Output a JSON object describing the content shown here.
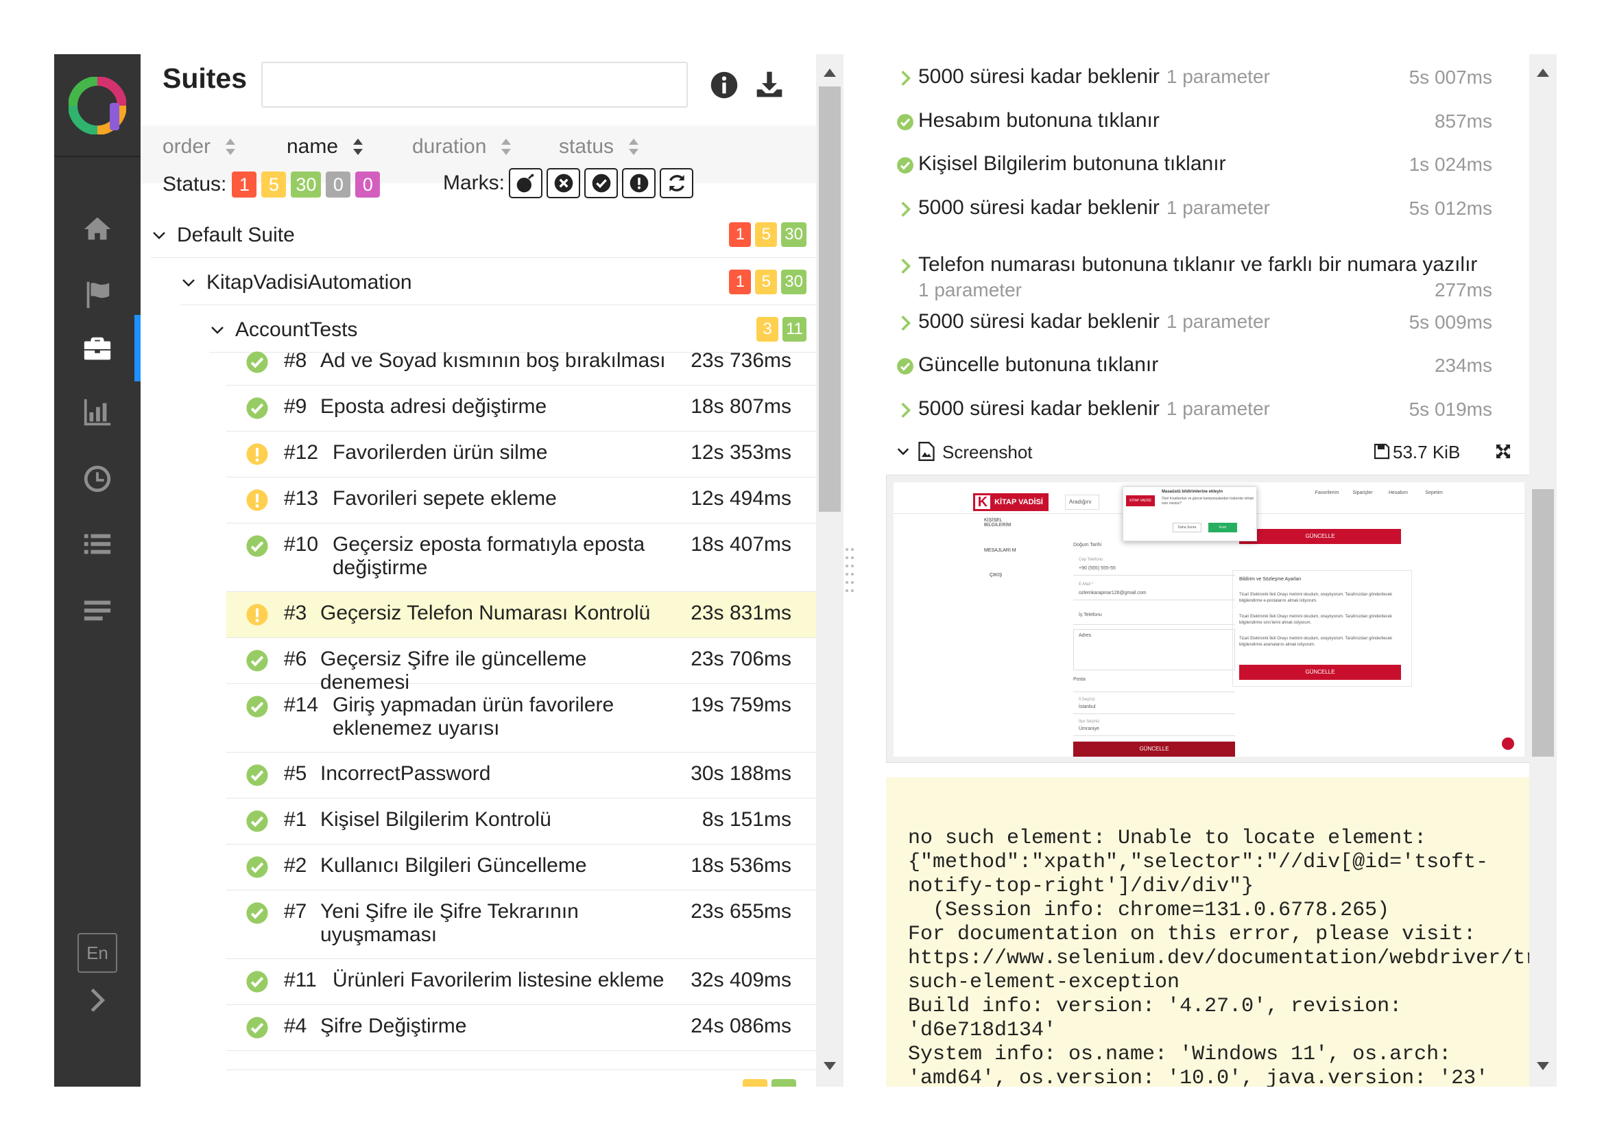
{
  "suites": {
    "title": "Suites",
    "search_placeholder": "",
    "sort": [
      {
        "label": "order"
      },
      {
        "label": "name"
      },
      {
        "label": "duration"
      },
      {
        "label": "status"
      }
    ],
    "status_label": "Status:",
    "status_counts": {
      "failed": "1",
      "broken": "5",
      "passed": "30",
      "skipped": "0",
      "unknown": "0"
    },
    "marks_label": "Marks:",
    "mark_icons": [
      "flaky-bomb-icon",
      "new-failed-icon",
      "new-passed-icon",
      "new-broken-icon",
      "retries-icon"
    ],
    "tree": {
      "default_suite": {
        "label": "Default Suite",
        "badges": [
          "1",
          "5",
          "30"
        ]
      },
      "package": {
        "label": "KitapVadisiAutomation",
        "badges": [
          "1",
          "5",
          "30"
        ]
      },
      "class": {
        "label": "AccountTests",
        "badges": [
          "3",
          "11"
        ]
      }
    },
    "tests": [
      {
        "num": "#8",
        "name": "Ad ve Soyad kısmının boş bırakılması",
        "duration": "23s 736ms",
        "status": "passed"
      },
      {
        "num": "#9",
        "name": "Eposta adresi değiştirme",
        "duration": "18s 807ms",
        "status": "passed"
      },
      {
        "num": "#12",
        "name": "Favorilerden ürün silme",
        "duration": "12s 353ms",
        "status": "broken"
      },
      {
        "num": "#13",
        "name": "Favorileri sepete ekleme",
        "duration": "12s 494ms",
        "status": "broken"
      },
      {
        "num": "#10",
        "name": "Geçersiz eposta formatıyla eposta değiştirme",
        "duration": "18s 407ms",
        "status": "passed"
      },
      {
        "num": "#3",
        "name": "Geçersiz Telefon Numarası Kontrolü",
        "duration": "23s 831ms",
        "status": "broken"
      },
      {
        "num": "#6",
        "name": "Geçersiz Şifre ile güncelleme denemesi",
        "duration": "23s 706ms",
        "status": "passed"
      },
      {
        "num": "#14",
        "name": "Giriş yapmadan ürün favorilere eklenemez uyarısı",
        "duration": "19s 759ms",
        "status": "passed"
      },
      {
        "num": "#5",
        "name": "IncorrectPassword",
        "duration": "30s 188ms",
        "status": "passed"
      },
      {
        "num": "#1",
        "name": "Kişisel Bilgilerim Kontrolü",
        "duration": "8s 151ms",
        "status": "passed"
      },
      {
        "num": "#2",
        "name": "Kullanıcı Bilgileri Güncelleme",
        "duration": "18s 536ms",
        "status": "passed"
      },
      {
        "num": "#7",
        "name": "Yeni Şifre ile Şifre Tekrarının uyuşmaması",
        "duration": "23s 655ms",
        "status": "passed"
      },
      {
        "num": "#11",
        "name": "Ürünleri Favorilerim listesine ekleme",
        "duration": "32s 409ms",
        "status": "passed"
      },
      {
        "num": "#4",
        "name": "Şifre Değiştirme",
        "duration": "24s 086ms",
        "status": "passed"
      }
    ]
  },
  "language": "En",
  "details": {
    "steps": [
      {
        "name": "5000 süresi kadar beklenir",
        "param": "1 parameter",
        "duration": "5s 007ms",
        "icon": "chevron-right"
      },
      {
        "name": "Hesabım butonuna tıklanır",
        "param": "",
        "duration": "857ms",
        "icon": "passed"
      },
      {
        "name": "Kişisel Bilgilerim butonuna tıklanır",
        "param": "",
        "duration": "1s 024ms",
        "icon": "passed"
      },
      {
        "name": "5000 süresi kadar beklenir",
        "param": "1 parameter",
        "duration": "5s 012ms",
        "icon": "chevron-right"
      },
      {
        "name": "Telefon numarası butonuna tıklanır ve farklı bir numara yazılır",
        "param": "1 parameter",
        "duration": "277ms",
        "icon": "chevron-right"
      },
      {
        "name": "5000 süresi kadar beklenir",
        "param": "1 parameter",
        "duration": "5s 009ms",
        "icon": "chevron-right"
      },
      {
        "name": "Güncelle butonuna tıklanır",
        "param": "",
        "duration": "234ms",
        "icon": "passed"
      },
      {
        "name": "5000 süresi kadar beklenir",
        "param": "1 parameter",
        "duration": "5s 019ms",
        "icon": "chevron-right"
      }
    ],
    "attachment": {
      "label": "Screenshot",
      "size": "53.7 KiB"
    },
    "screenshot": {
      "brand": "KİTAP VADİSİ",
      "side_menu": [
        "KİŞİSEL BİLGİLERİM",
        "MESAJLARI M",
        "ÇIKIŞ"
      ],
      "search_text": "Aradığını",
      "popup_title": "Masaüstü bildirimlerine ekleyin",
      "popup_text": "Özel fırsatlardan ve güncel kampanyalardan haberdar olmak ister misiniz?",
      "popup_cancel": "Daha Sonra",
      "popup_ok": "Evet",
      "header_links": [
        "Favorilerim",
        "Siparişler",
        "Hesabım",
        "Sepetim"
      ],
      "field_labels": [
        "Doğum Tarihi",
        "Cep Telefonu",
        "E-Mail *",
        "İş Telefonu",
        "Adres",
        "Posta",
        "İl Seçiniz",
        "İlçe Seçiniz"
      ],
      "field_values": [
        "+90 (555) 555-55",
        "ozlemkarapinar126@gmail.com",
        "İstanbul",
        "Ümraniye"
      ],
      "update_button": "GÜNCELLE",
      "settings_title": "Bildirim ve Sözleşme Ayarları",
      "settings_items": [
        "Ticari Elektronik İleti Onayı metnini okudum, onaylıyorum. Tarafınızdan gönderilecek bilgilendirme e-postalarını almak istiyorum.",
        "Ticari Elektronik İleti Onayı metnini okudum, onaylıyorum. Tarafınızdan gönderilecek bilgilendirme sms'lerini almak istiyorum.",
        "Ticari Elektronik İleti Onayı metnini okudum, onaylıyorum. Tarafınızdan gönderilecek bilgilendirme aramalarını almak istiyorum."
      ]
    },
    "error": "no such element: Unable to locate element:\n{\"method\":\"xpath\",\"selector\":\"//div[@id='tsoft-\nnotify-top-right']/div/div\"}\n  (Session info: chrome=131.0.6778.265)\nFor documentation on this error, please visit:\nhttps://www.selenium.dev/documentation/webdriver/troubleshooting/errors#no-\nsuch-element-exception\nBuild info: version: '4.27.0', revision:\n'd6e718d134'\nSystem info: os.name: 'Windows 11', os.arch:\n'amd64', os.version: '10.0', java.version: '23'"
  },
  "colors": {
    "failed": "#fd5a3e",
    "broken": "#ffd050",
    "passed": "#97cc64",
    "skipped": "#aaaaaa",
    "unknown": "#d35ebe",
    "sidebar": "#343434",
    "selected_row": "#fcfad2",
    "error_bg": "#fcf9dc",
    "brand_red": "#c8102e"
  }
}
